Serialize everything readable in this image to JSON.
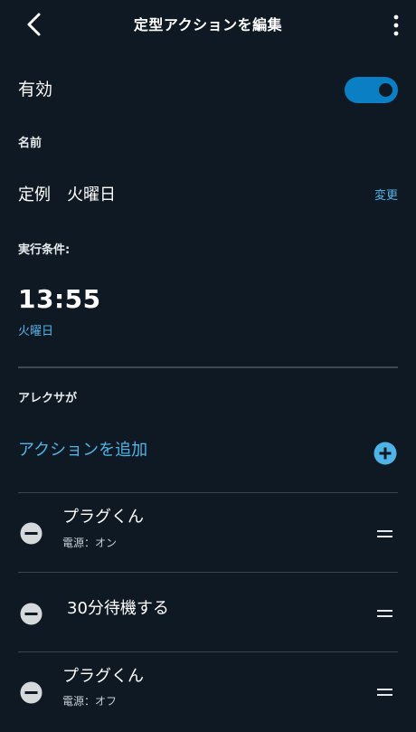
{
  "header": {
    "title": "定型アクションを編集"
  },
  "enabled": {
    "label": "有効",
    "value": true,
    "accent_color": "#0a7fc4"
  },
  "name_section": {
    "label": "名前",
    "value": "定例　火曜日",
    "change_label": "変更"
  },
  "trigger_section": {
    "label": "実行条件:",
    "time": "13:55",
    "day": "火曜日"
  },
  "alexa_section": {
    "label": "アレクサが",
    "add_action_label": "アクションを追加",
    "actions": [
      {
        "title": "プラグくん",
        "subtitle": "電源：オン"
      },
      {
        "title": "30分待機する",
        "subtitle": ""
      },
      {
        "title": "プラグくん",
        "subtitle": "電源：オフ"
      }
    ]
  },
  "icons": {
    "back": "chevron-left-icon",
    "more": "more-vertical-icon",
    "add": "plus-circle-icon",
    "remove": "minus-circle-icon",
    "drag": "drag-handle-icon"
  },
  "colors": {
    "background": "#0f1923",
    "link": "#4fb3e8"
  }
}
